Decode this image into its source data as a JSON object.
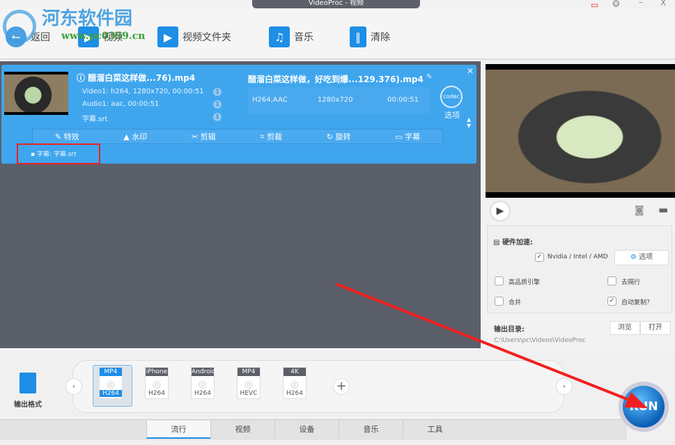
{
  "window": {
    "title": "VideoProc - 视频"
  },
  "watermark": {
    "name": "河东软件园",
    "url": "www.pc0359.cn"
  },
  "toolbar": {
    "back": "返回",
    "video": "视频",
    "folder": "视频文件夹",
    "music": "音乐",
    "clear": "清除"
  },
  "card": {
    "source_name": "醋溜白菜这样做...76).mp4",
    "video_track": "Video1: h264, 1280x720, 00:00:51",
    "audio_track": "Audio1: aac, 00:00:51",
    "subtitle_track": "字幕.srt",
    "badge": "1",
    "output_name": "醋溜白菜这样做，好吃到爆...129.376).mp4",
    "codec": "H264,AAC",
    "resolution": "1280x720",
    "duration": "00:00:51",
    "codec_option": "选项",
    "edit": [
      "特效",
      "水印",
      "剪辑",
      "剪裁",
      "旋转",
      "字幕"
    ],
    "subtitle_info": "字幕:  字幕.srt"
  },
  "settings": {
    "hw_label": "硬件加速:",
    "hw_option": "Nvidia / Intel / AMD",
    "options_btn": "选项",
    "high_quality": "高品质引擎",
    "deinterlace": "去隔行",
    "merge": "合并",
    "auto_copy": "自动复制？",
    "output_dir_label": "输出目录:",
    "browse": "浏览",
    "open": "打开",
    "output_path": "C:\\Users\\pc\\Videos\\VideoProc"
  },
  "formats": {
    "label": "输出格式",
    "items": [
      {
        "top": "MP4",
        "bottom": "H264"
      },
      {
        "top": "iPhone",
        "bottom": "H264"
      },
      {
        "top": "Android",
        "bottom": "H264"
      },
      {
        "top": "MP4",
        "bottom": "HEVC"
      },
      {
        "top": "4K",
        "bottom": "H264"
      }
    ]
  },
  "tabs": [
    "流行",
    "视频",
    "设备",
    "音乐",
    "工具"
  ],
  "run": "RUN"
}
